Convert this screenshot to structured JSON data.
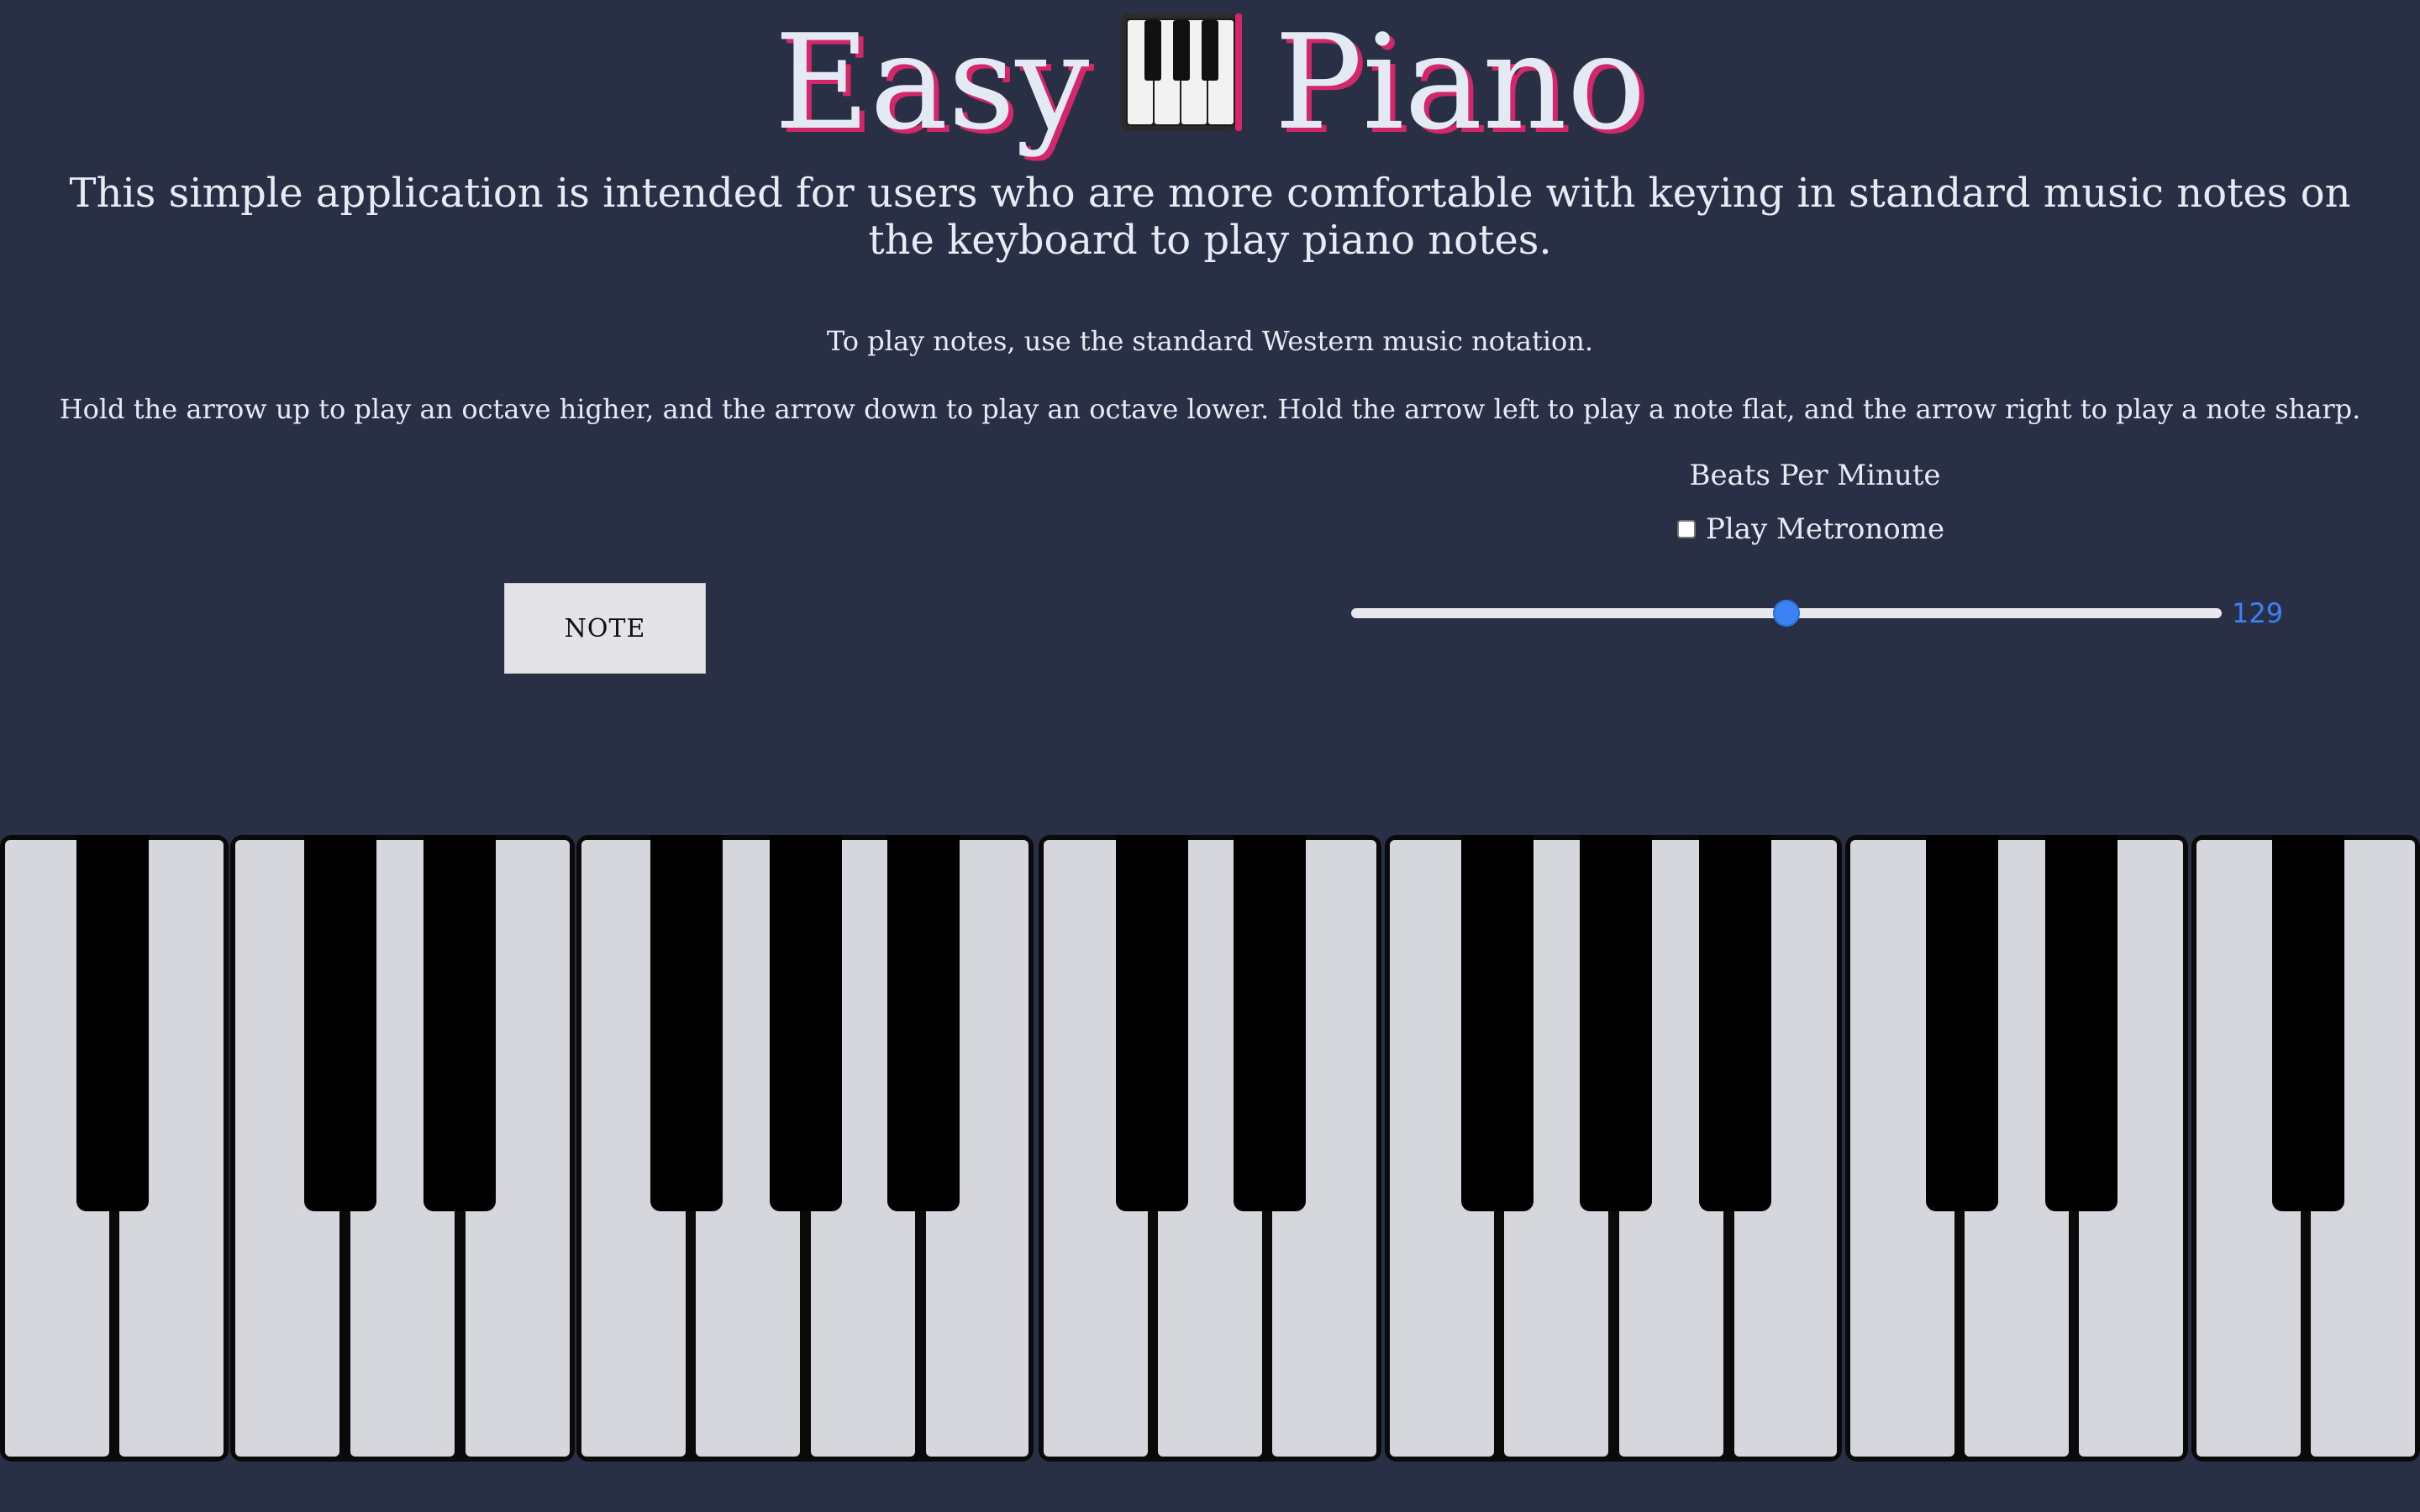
{
  "header": {
    "title_left": "Easy",
    "title_right": "Piano",
    "title_icon": "musical-keyboard-icon",
    "title_shadow_color": "#d4266b"
  },
  "intro_text": "This simple application is intended for users who are more comfortable with keying in standard music notes on the keyboard to play piano notes.",
  "instructions": [
    "To play notes, use the standard Western music notation.",
    "Hold the arrow up to play an octave higher, and the arrow down to play an octave lower. Hold the arrow left to play a note flat, and the arrow right to play a note sharp."
  ],
  "note_button": {
    "label": "NOTE"
  },
  "metronome": {
    "bpm_label": "Beats Per Minute",
    "checkbox_label": "Play Metronome",
    "checked": false,
    "bpm_value": "129",
    "slider_fraction": 0.5,
    "accent_color": "#3b82f6"
  },
  "colors": {
    "background": "#293046",
    "text": "#e7ebf3",
    "white_key": "#d6d7dc",
    "black_key": "#000000"
  }
}
